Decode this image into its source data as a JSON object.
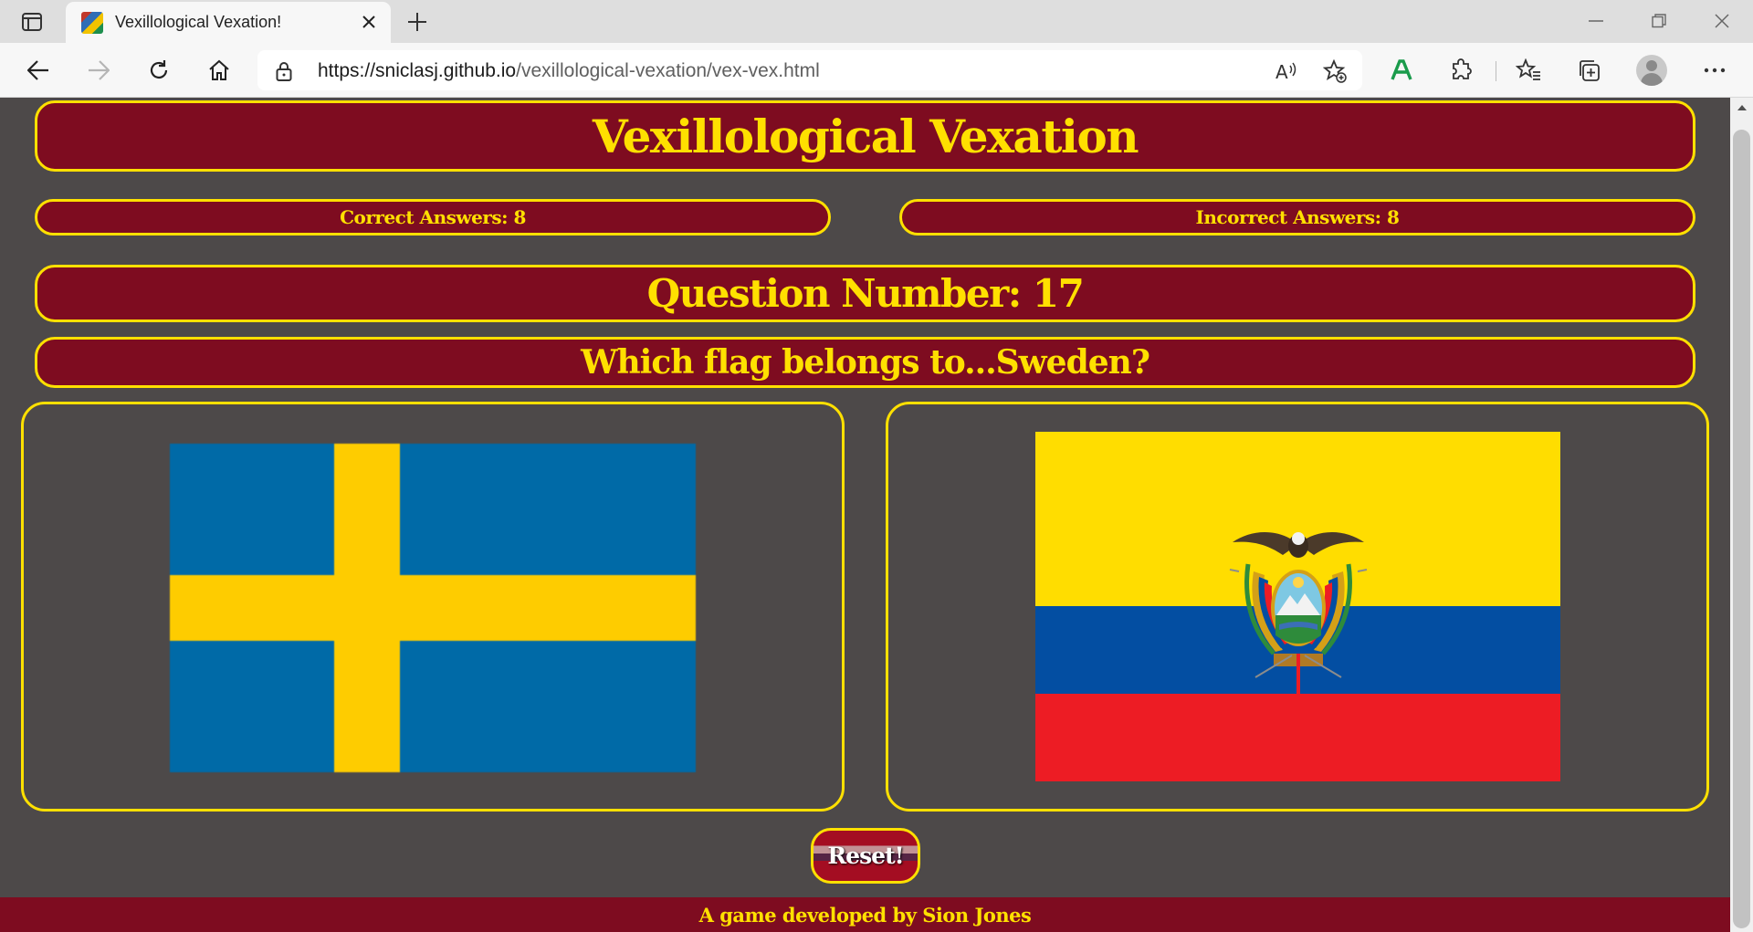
{
  "browser": {
    "tab_title": "Vexillological Vexation!",
    "url_host": "https://sniclasj.github.io",
    "url_path": "/vexillological-vexation/vex-vex.html",
    "icons": [
      "tab-actions-icon",
      "close-icon",
      "plus-icon",
      "minimize-icon",
      "restore-icon",
      "window-close-icon",
      "back-icon",
      "forward-icon",
      "refresh-icon",
      "home-icon",
      "lock-icon",
      "read-aloud-icon",
      "add-favorite-icon",
      "grammar-extension-icon",
      "extensions-icon",
      "favorites-icon",
      "collections-icon",
      "profile-icon",
      "more-icon"
    ]
  },
  "game": {
    "title": "Vexillological Vexation",
    "correct_label": "Correct Answers: 8",
    "incorrect_label": "Incorrect Answers: 8",
    "question_number": "Question Number: 17",
    "prompt": "Which flag belongs to...Sweden?",
    "options": [
      {
        "flag": "sweden-flag",
        "colors": [
          "#006aa7",
          "#fecc00"
        ]
      },
      {
        "flag": "ecuador-flag",
        "colors": [
          "#ffdd00",
          "#034ea2",
          "#ed1c24"
        ]
      }
    ],
    "reset_label": "Reset!",
    "footer": "A game developed by Sion Jones"
  },
  "colors": {
    "background": "#4d4949",
    "banner": "#7e0c20",
    "accent": "#ffe000"
  }
}
